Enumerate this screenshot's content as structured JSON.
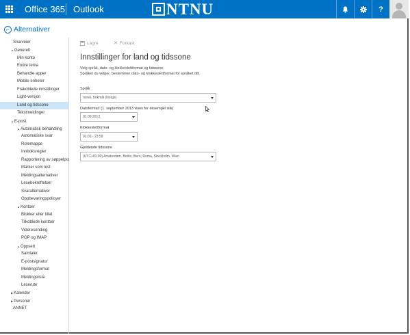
{
  "topbar": {
    "app_suite": "Office 365",
    "app_name": "Outlook",
    "logo_text": "NTNU",
    "accent": "#0072c6",
    "icons": [
      "bell-icon",
      "gear-icon",
      "help-icon"
    ],
    "help_label": "?"
  },
  "header": {
    "back_label": "Alternativer"
  },
  "sidebar": {
    "items": [
      {
        "label": "Snarveier",
        "indent": 1,
        "tri": "",
        "selected": false
      },
      {
        "label": "Generelt",
        "indent": 0,
        "tri": "▲",
        "selected": false
      },
      {
        "label": "Min konto",
        "indent": 2,
        "tri": "",
        "selected": false
      },
      {
        "label": "Endre tema",
        "indent": 2,
        "tri": "",
        "selected": false
      },
      {
        "label": "Behandle apper",
        "indent": 2,
        "tri": "",
        "selected": false
      },
      {
        "label": "Mobile enheter",
        "indent": 2,
        "tri": "",
        "selected": false
      },
      {
        "label": "Frakoblede innstillinger",
        "indent": 2,
        "tri": "",
        "selected": false
      },
      {
        "label": "Light-versjon",
        "indent": 2,
        "tri": "",
        "selected": false
      },
      {
        "label": "Land og tidssone",
        "indent": 2,
        "tri": "",
        "selected": true
      },
      {
        "label": "Tekstmeldinger",
        "indent": 2,
        "tri": "",
        "selected": false
      },
      {
        "label": "E-post",
        "indent": 0,
        "tri": "▲",
        "selected": false
      },
      {
        "label": "Automatisk behandling",
        "indent": 2,
        "tri": "▲",
        "selected": false
      },
      {
        "label": "Automatiske svar",
        "indent": 3,
        "tri": "",
        "selected": false
      },
      {
        "label": "Rotemappe",
        "indent": 3,
        "tri": "",
        "selected": false
      },
      {
        "label": "Innboksregler",
        "indent": 3,
        "tri": "",
        "selected": false
      },
      {
        "label": "Rapportering av søppelpost",
        "indent": 3,
        "tri": "",
        "selected": false
      },
      {
        "label": "Marker som lest",
        "indent": 3,
        "tri": "",
        "selected": false
      },
      {
        "label": "Meldingsalternativer",
        "indent": 3,
        "tri": "",
        "selected": false
      },
      {
        "label": "Lesebekreftelser",
        "indent": 3,
        "tri": "",
        "selected": false
      },
      {
        "label": "Svaralternativer",
        "indent": 3,
        "tri": "",
        "selected": false
      },
      {
        "label": "Oppbevaringspolicyer",
        "indent": 3,
        "tri": "",
        "selected": false
      },
      {
        "label": "Kontoer",
        "indent": 2,
        "tri": "▲",
        "selected": false
      },
      {
        "label": "Blokker eller tillat",
        "indent": 3,
        "tri": "",
        "selected": false
      },
      {
        "label": "Tilkoblede kontoer",
        "indent": 3,
        "tri": "",
        "selected": false
      },
      {
        "label": "Videresending",
        "indent": 3,
        "tri": "",
        "selected": false
      },
      {
        "label": "POP og IMAP",
        "indent": 3,
        "tri": "",
        "selected": false
      },
      {
        "label": "Oppsett",
        "indent": 2,
        "tri": "▲",
        "selected": false
      },
      {
        "label": "Samtaler",
        "indent": 3,
        "tri": "",
        "selected": false
      },
      {
        "label": "E-postsignatur",
        "indent": 3,
        "tri": "",
        "selected": false
      },
      {
        "label": "Meldingsformat",
        "indent": 3,
        "tri": "",
        "selected": false
      },
      {
        "label": "Meldingsliste",
        "indent": 3,
        "tri": "",
        "selected": false
      },
      {
        "label": "Leserute",
        "indent": 3,
        "tri": "",
        "selected": false
      },
      {
        "label": "Kalender",
        "indent": 0,
        "tri": "▶",
        "selected": false
      },
      {
        "label": "Personer",
        "indent": 0,
        "tri": "▶",
        "selected": false
      },
      {
        "label": "ANNET",
        "indent": 1,
        "tri": "",
        "selected": false
      }
    ]
  },
  "toolbar": {
    "save_label": "Lagre",
    "discard_label": "Forkast"
  },
  "main": {
    "title": "Innstillinger for land og tidssone",
    "description_1": "Velg språk, dato- og klokkeslettformat og tidssone.",
    "description_2": "Språket du velger, bestemmer dato- og klokkeslettformat for språket ditt.",
    "language_label": "Språk",
    "language_value": "norsk, bokmål (Norge)",
    "date_label": "Datoformat: (1. september 2013 vises for eksempel slik)",
    "date_value": "01.09.2013",
    "time_label": "Klokkeslettformat",
    "time_value": "01:01 - 23:59",
    "timezone_label": "Gjeldende tidssone",
    "timezone_value": "(UTC+01:00) Amsterdam, Berlin, Bern, Roma, Stockholm, Wien"
  }
}
